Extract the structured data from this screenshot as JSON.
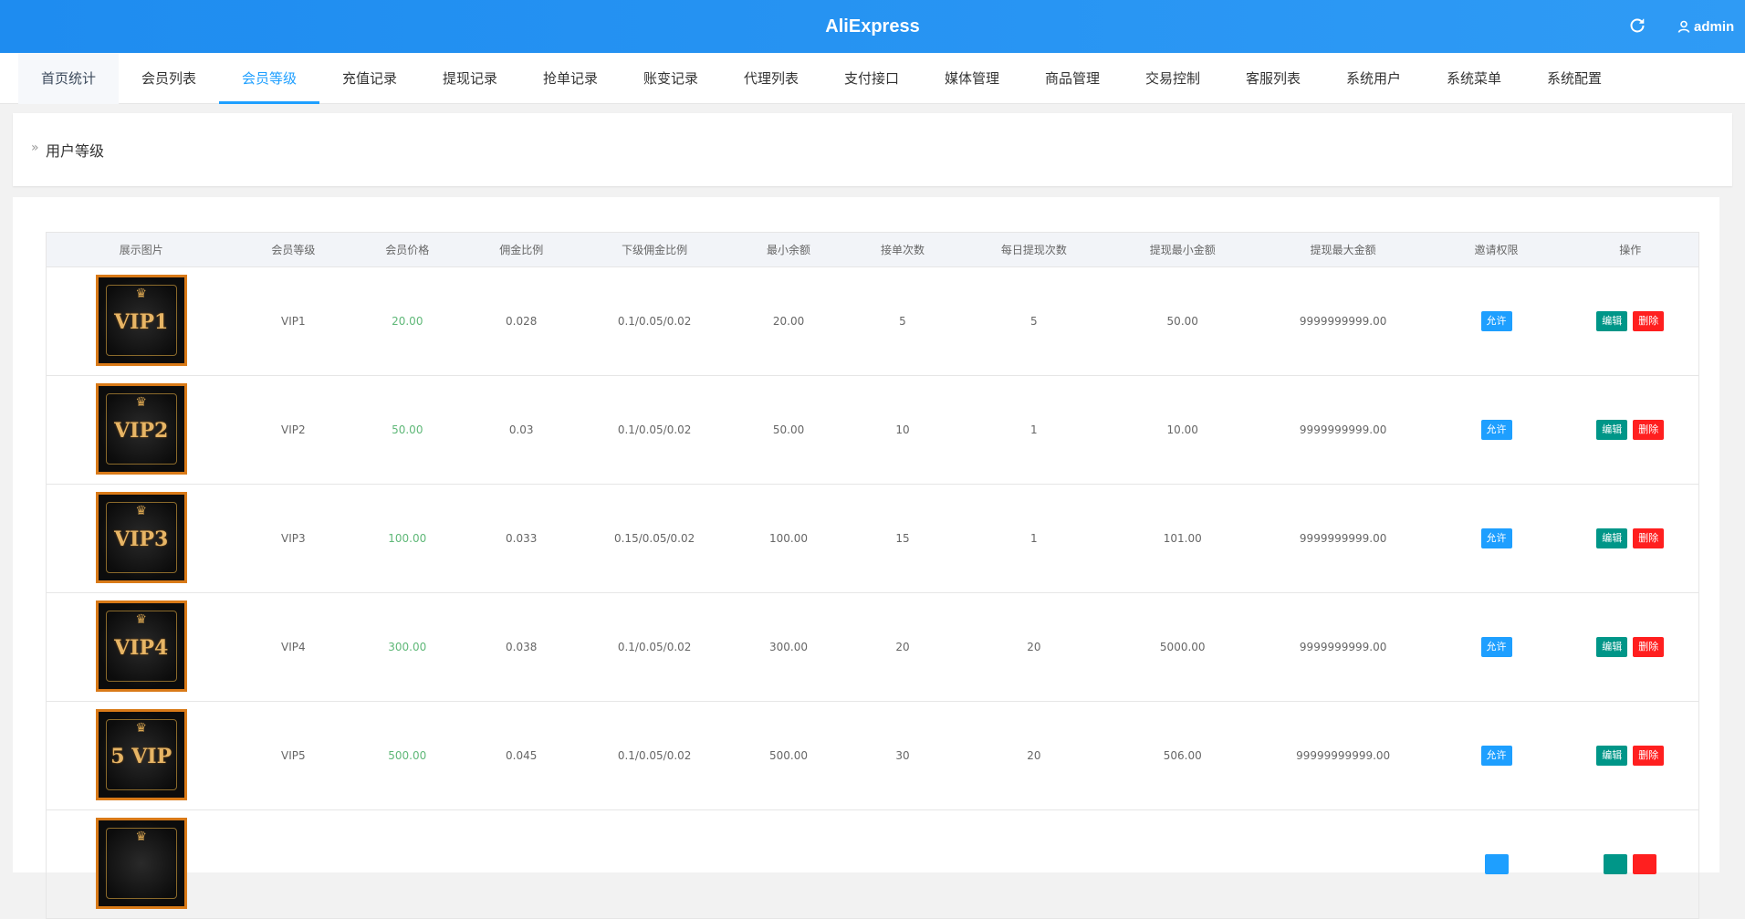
{
  "header": {
    "title": "AliExpress",
    "user": "admin",
    "refresh_icon": "refresh-icon",
    "user_icon": "user-icon"
  },
  "nav": [
    "首页统计",
    "会员列表",
    "会员等级",
    "充值记录",
    "提现记录",
    "抢单记录",
    "账变记录",
    "代理列表",
    "支付接口",
    "媒体管理",
    "商品管理",
    "交易控制",
    "客服列表",
    "系统用户",
    "系统菜单",
    "系统配置"
  ],
  "breadcrumb": "用户等级",
  "table": {
    "headers": [
      "展示图片",
      "会员等级",
      "会员价格",
      "佣金比例",
      "下级佣金比例",
      "最小余额",
      "接单次数",
      "每日提现次数",
      "提现最小金额",
      "提现最大金额",
      "邀请权限",
      "操作"
    ],
    "rows": [
      {
        "image_text": "VIP1",
        "level": "VIP1",
        "price": "20.00",
        "commission": "0.028",
        "sub_commission": "0.1/0.05/0.02",
        "min_balance": "20.00",
        "orders": "5",
        "daily_withdraw": "5",
        "withdraw_min": "50.00",
        "withdraw_max": "9999999999.00",
        "invite": "允许",
        "edit": "编辑",
        "delete": "删除"
      },
      {
        "image_text": "VIP2",
        "level": "VIP2",
        "price": "50.00",
        "commission": "0.03",
        "sub_commission": "0.1/0.05/0.02",
        "min_balance": "50.00",
        "orders": "10",
        "daily_withdraw": "1",
        "withdraw_min": "10.00",
        "withdraw_max": "9999999999.00",
        "invite": "允许",
        "edit": "编辑",
        "delete": "删除"
      },
      {
        "image_text": "VIP3",
        "level": "VIP3",
        "price": "100.00",
        "commission": "0.033",
        "sub_commission": "0.15/0.05/0.02",
        "min_balance": "100.00",
        "orders": "15",
        "daily_withdraw": "1",
        "withdraw_min": "101.00",
        "withdraw_max": "9999999999.00",
        "invite": "允许",
        "edit": "编辑",
        "delete": "删除"
      },
      {
        "image_text": "VIP4",
        "level": "VIP4",
        "price": "300.00",
        "commission": "0.038",
        "sub_commission": "0.1/0.05/0.02",
        "min_balance": "300.00",
        "orders": "20",
        "daily_withdraw": "20",
        "withdraw_min": "5000.00",
        "withdraw_max": "9999999999.00",
        "invite": "允许",
        "edit": "编辑",
        "delete": "删除"
      },
      {
        "image_text": "5 VIP",
        "level": "VIP5",
        "price": "500.00",
        "commission": "0.045",
        "sub_commission": "0.1/0.05/0.02",
        "min_balance": "500.00",
        "orders": "30",
        "daily_withdraw": "20",
        "withdraw_min": "506.00",
        "withdraw_max": "99999999999.00",
        "invite": "允许",
        "edit": "编辑",
        "delete": "删除"
      },
      {
        "image_text": "",
        "level": "",
        "price": "",
        "commission": "",
        "sub_commission": "",
        "min_balance": "",
        "orders": "",
        "daily_withdraw": "",
        "withdraw_min": "",
        "withdraw_max": "",
        "invite": "",
        "edit": "",
        "delete": ""
      }
    ]
  },
  "colors": {
    "topbar": "#1e8cf0",
    "accent": "#1e9fff",
    "price": "#5fb878",
    "edit": "#009688",
    "delete": "#ff1f1f"
  }
}
